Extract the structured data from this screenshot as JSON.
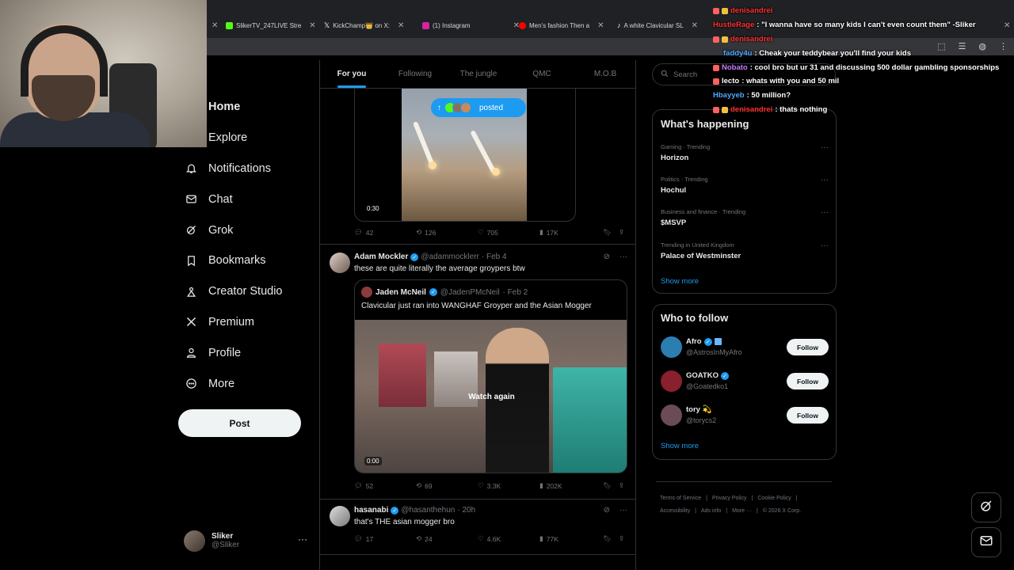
{
  "browser": {
    "tabs": [
      {
        "title": "SlikerTV_247LIVE Stre",
        "fav_color": "#53fc18"
      },
      {
        "title": "KickChamp👑 on X:",
        "fav_color": "#ffffff"
      },
      {
        "title": "(1) Instagram",
        "fav_color": "#d6249f"
      },
      {
        "title": "Men's fashion Then a",
        "fav_color": "#ff0000"
      },
      {
        "title": "A white Clavicular SL",
        "fav_color": "#25f4ee"
      }
    ]
  },
  "nav": {
    "items": [
      {
        "label": "Home",
        "icon": "home-icon",
        "active": true
      },
      {
        "label": "Explore",
        "icon": "explore-icon"
      },
      {
        "label": "Notifications",
        "icon": "bell-icon"
      },
      {
        "label": "Chat",
        "icon": "mail-icon"
      },
      {
        "label": "Grok",
        "icon": "grok-icon"
      },
      {
        "label": "Bookmarks",
        "icon": "bookmark-icon"
      },
      {
        "label": "Creator Studio",
        "icon": "creator-icon"
      },
      {
        "label": "Premium",
        "icon": "x-logo-icon"
      },
      {
        "label": "Profile",
        "icon": "person-icon"
      },
      {
        "label": "More",
        "icon": "more-circle-icon"
      }
    ],
    "post_label": "Post",
    "account": {
      "name": "Sliker",
      "handle": "@Sliker"
    }
  },
  "timeline": {
    "tabs": [
      "For you",
      "Following",
      "The jungle",
      "QMC",
      "M.O.B"
    ],
    "posted_pill": "posted",
    "first_media": {
      "duration": "0:30"
    },
    "first_stats": {
      "replies": "42",
      "reposts": "126",
      "likes": "705",
      "views": "17K"
    },
    "tweet2": {
      "name": "Adam Mockler",
      "handle": "@adammocklerr",
      "date": "· Feb 4",
      "text": "these are quite literally the average groypers btw",
      "quote": {
        "name": "Jaden McNeil",
        "handle": "@JadenPMcNeil",
        "date": "· Feb 2",
        "text": "Clavicular just ran into WANGHAF Groyper and the Asian Mogger",
        "overlay": "Watch again",
        "duration": "0:00"
      },
      "stats": {
        "replies": "52",
        "reposts": "69",
        "likes": "3.3K",
        "views": "202K"
      }
    },
    "tweet3": {
      "name": "hasanabi",
      "handle": "@hasanthehun",
      "date": "· 20h",
      "text": "that's THE asian mogger bro",
      "stats": {
        "replies": "17",
        "reposts": "24",
        "likes": "4.6K",
        "views": "77K"
      }
    }
  },
  "sidebar": {
    "search_placeholder": "Search",
    "happening_title": "What's happening",
    "trends": [
      {
        "meta": "Gaming · Trending",
        "name": "Horizon"
      },
      {
        "meta": "Politics · Trending",
        "name": "Hochul"
      },
      {
        "meta": "Business and finance · Trending",
        "name": "$MSVP"
      },
      {
        "meta": "Trending in United Kingdom",
        "name": "Palace of Westminster"
      }
    ],
    "show_more": "Show more",
    "wtf_title": "Who to follow",
    "suggestions": [
      {
        "name": "Afro",
        "handle": "@AstrosInMyAfro",
        "follow": "Follow",
        "color": "#2a7fb0"
      },
      {
        "name": "GOATKO",
        "handle": "@Goatedko1",
        "follow": "Follow",
        "color": "#8a1f2d"
      },
      {
        "name": "tory 💫",
        "handle": "@torycs2",
        "follow": "Follow",
        "color": "#6b4b55"
      }
    ],
    "footer": [
      "Terms of Service",
      "|",
      "Privacy Policy",
      "|",
      "Cookie Policy",
      "|",
      "Accessibility",
      "|",
      "Ads info",
      "|",
      "More ···",
      "|",
      "© 2026 X Corp."
    ]
  },
  "chat": [
    {
      "user": "denisandrei",
      "color": "#ff3030",
      "text": ""
    },
    {
      "user": "HustleRage",
      "color": "#ff3030",
      "text": ": \"I wanna have so many kids I can't even count them\" -Sliker"
    },
    {
      "user": "denisandrei",
      "color": "#ff3030",
      "text": ""
    },
    {
      "user": "faddy4u",
      "color": "#4fa8ff",
      "text": ": Cheak your teddybear you'll find your kids"
    },
    {
      "user": "Nobato",
      "color": "#c77dff",
      "text": ": cool bro but ur 31 and discussing 500 dollar gambling sponsorships"
    },
    {
      "user": "lecto",
      "color": "#ffffff",
      "text": ": whats with you and 50 mil"
    },
    {
      "user": "Hbayyeb",
      "color": "#4fa8ff",
      "text": ": 50 million?"
    },
    {
      "user": "denisandrei",
      "color": "#ff3030",
      "text": ": thats nothing"
    }
  ]
}
